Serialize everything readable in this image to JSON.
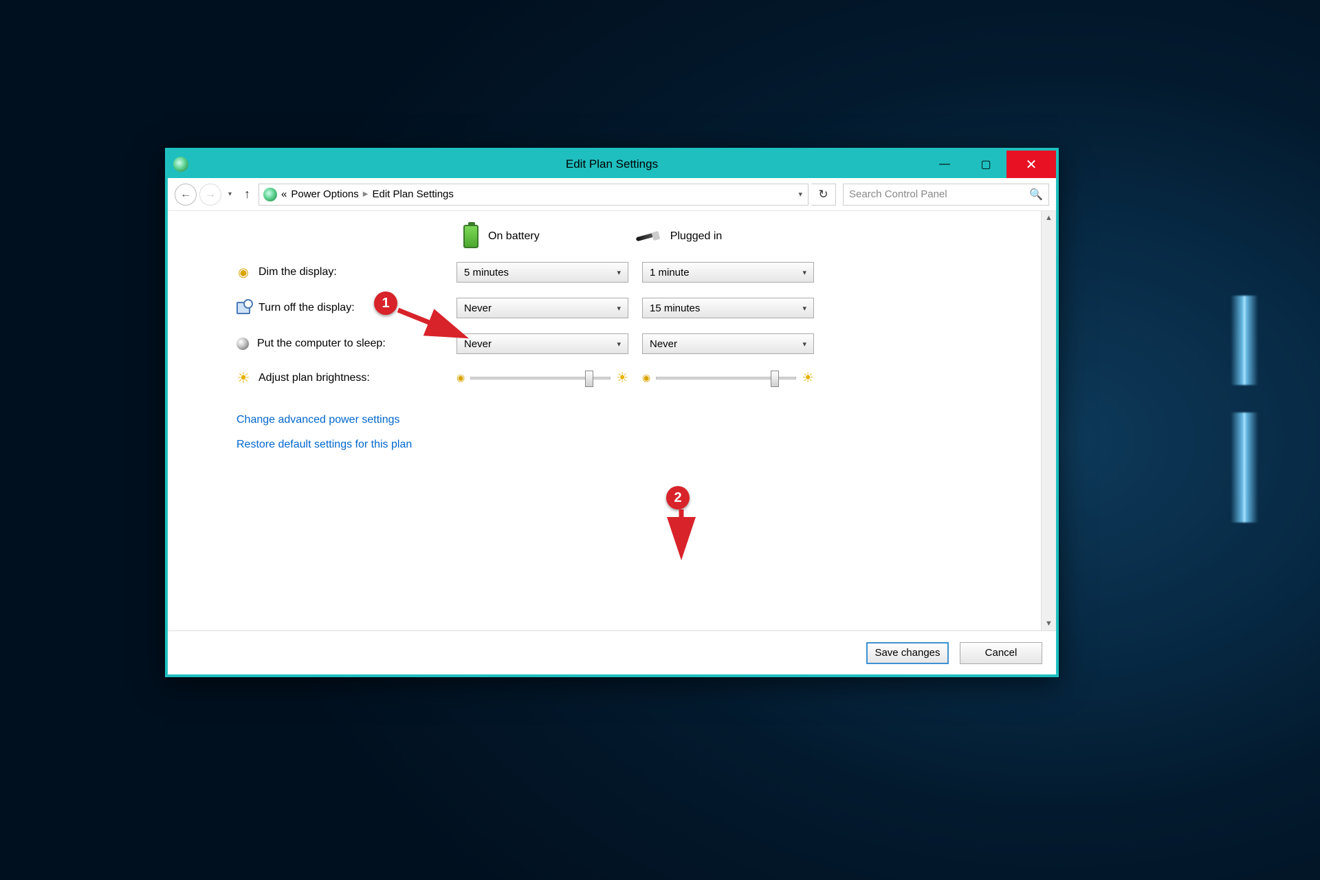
{
  "window": {
    "title": "Edit Plan Settings"
  },
  "toolbar": {
    "breadcrumb_prefix": "«",
    "crumbs": [
      "Power Options",
      "Edit Plan Settings"
    ],
    "search_placeholder": "Search Control Panel"
  },
  "columns": {
    "battery": "On battery",
    "plugged": "Plugged in"
  },
  "settings": {
    "dim": {
      "label": "Dim the display:",
      "battery": "5 minutes",
      "plugged": "1 minute"
    },
    "off": {
      "label": "Turn off the display:",
      "battery": "Never",
      "plugged": "15 minutes"
    },
    "sleep": {
      "label": "Put the computer to sleep:",
      "battery": "Never",
      "plugged": "Never"
    },
    "bright": {
      "label": "Adjust plan brightness:"
    }
  },
  "brightness": {
    "battery_pct": 82,
    "plugged_pct": 82
  },
  "links": {
    "advanced": "Change advanced power settings",
    "restore": "Restore default settings for this plan"
  },
  "buttons": {
    "save": "Save changes",
    "cancel": "Cancel"
  },
  "annotations": {
    "one": "1",
    "two": "2"
  }
}
